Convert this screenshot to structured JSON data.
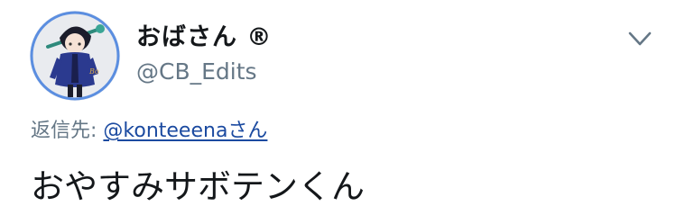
{
  "tweet": {
    "display_name": "おばさん ®",
    "handle": "@CB_Edits",
    "reply_prefix": "返信先: ",
    "reply_to": "@konteeenaさん",
    "text": "おやすみサボテンくん",
    "avatar_icon": "character-avatar-icon",
    "menu_icon": "chevron-down-icon"
  },
  "colors": {
    "handle": "#657786",
    "link": "#1b4aa0",
    "text": "#14171a",
    "avatar_border": "#5b8ee0"
  }
}
